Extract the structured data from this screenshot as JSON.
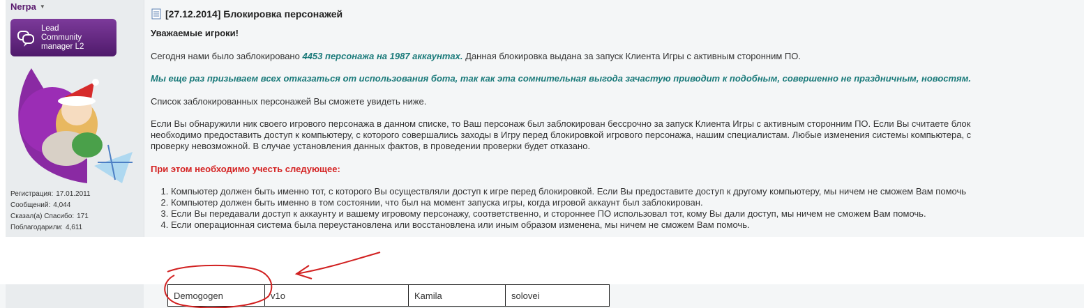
{
  "user": {
    "name": "Nerpa",
    "rank": [
      "Lead",
      "Community",
      "manager L2"
    ],
    "stats": [
      {
        "label": "Регистрация:",
        "value": "17.01.2011"
      },
      {
        "label": "Сообщений:",
        "value": "4,044"
      },
      {
        "label": "Сказал(а) Спасибо:",
        "value": "171"
      },
      {
        "label": "Поблагодарили:",
        "value": "4,611"
      }
    ]
  },
  "post": {
    "title": "[27.12.2014] Блокировка персонажей",
    "greeting": "Уважаемые игроки!",
    "line1_pre": "Сегодня нами было заблокировано",
    "line1_hl": "4453 персонажа на 1987 аккаунтах.",
    "line1_post": "Данная блокировка выдана за запуск Клиента Игры с активным сторонним ПО.",
    "appeal": "Мы еще раз призываем всех отказаться от использования бота, так как эта сомнительная выгода зачастую приводит к подобным, совершенно не праздничным, новостям.",
    "list_intro": "Список заблокированных персонажей Вы сможете увидеть ниже.",
    "para": [
      "Если Вы обнаружили ник своего игрового персонажа в данном списке, то Ваш персонаж был заблокирован бессрочно за запуск Клиента Игры с активным сторонним ПО. Если Вы считаете блок",
      "необходимо предоставить доступ к компьютеру, с которого совершались заходы в Игру перед блокировкой игрового персонажа, нашим специалистам. Любые изменения системы компьютера, с",
      "проверку невозможной. В случае установления данных фактов, в проведении проверки будет отказано."
    ],
    "warning": "При этом необходимо учесть следующее:",
    "items": [
      "Компьютер должен быть именно тот, с которого Вы осуществляли доступ к игре перед блокировкой. Если Вы предоставите доступ к другому компьютеру, мы ничем не сможем Вам помочь",
      "Компьютер должен быть именно в том состоянии, что был на момент запуска игры, когда игровой аккаунт был заблокирован.",
      "Если Вы передавали доступ к аккаунту и вашему игровому персонажу, соответственно, и стороннее ПО использовал тот, кому Вы дали доступ, мы ничем не сможем Вам помочь.",
      "Если операционная система была переустановлена или восстановлена или иным образом изменена, мы ничем не сможем Вам помочь."
    ]
  },
  "table": {
    "row": [
      "Demogogen",
      "v1o",
      "Kamila",
      "solovei"
    ]
  },
  "colors": {
    "accent_teal": "#1a7a7a",
    "warning_red": "#d42323",
    "annotation_red": "#d11f1f",
    "rank_purple": "#5a1a6e"
  },
  "icons": {
    "rank": "chat-bubble-icon",
    "post": "document-icon",
    "menu": "caret-down-icon"
  }
}
